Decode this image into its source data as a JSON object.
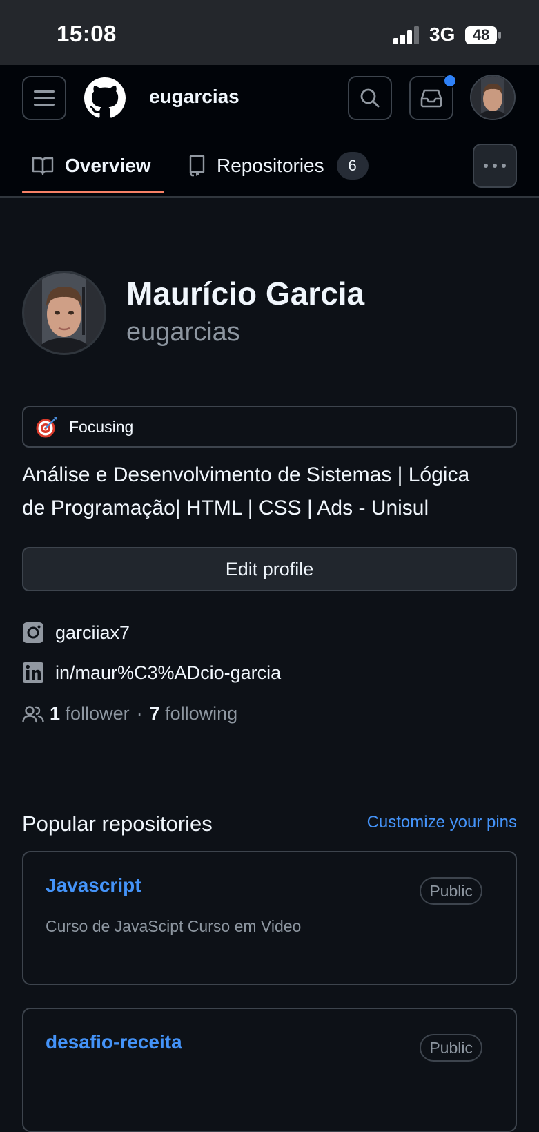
{
  "status_bar": {
    "time": "15:08",
    "network": "3G",
    "battery": "48"
  },
  "header": {
    "username": "eugarcias",
    "notification_dot_color": "#2f81f7"
  },
  "tabs": [
    {
      "label": "Overview",
      "icon": "book-icon",
      "selected": true
    },
    {
      "label": "Repositories",
      "icon": "repo-icon",
      "count": "6"
    }
  ],
  "profile": {
    "name": "Maurício Garcia",
    "login": "eugarcias",
    "status": {
      "emoji": "dart-target",
      "text": "Focusing"
    },
    "bio_line1": "Análise e Desenvolvimento de Sistemas | Lógica",
    "bio_line2": "de Programação| HTML | CSS | Ads - Unisul",
    "edit_button": "Edit profile",
    "instagram": "garciiax7",
    "linkedin": "in/maur%C3%ADcio-garcia",
    "followers_count": "1",
    "followers_label": "follower",
    "separator": "·",
    "following_count": "7",
    "following_label": "following"
  },
  "popular": {
    "title": "Popular repositories",
    "customize_link": "Customize your pins",
    "repos": [
      {
        "name": "Javascript",
        "visibility": "Public",
        "description": "Curso de JavaScipt Curso em Video"
      },
      {
        "name": "desafio-receita",
        "visibility": "Public",
        "description": ""
      }
    ]
  },
  "colors": {
    "accent": "#4493f8",
    "tab_underline": "#f78166",
    "background": "#0d1117"
  }
}
